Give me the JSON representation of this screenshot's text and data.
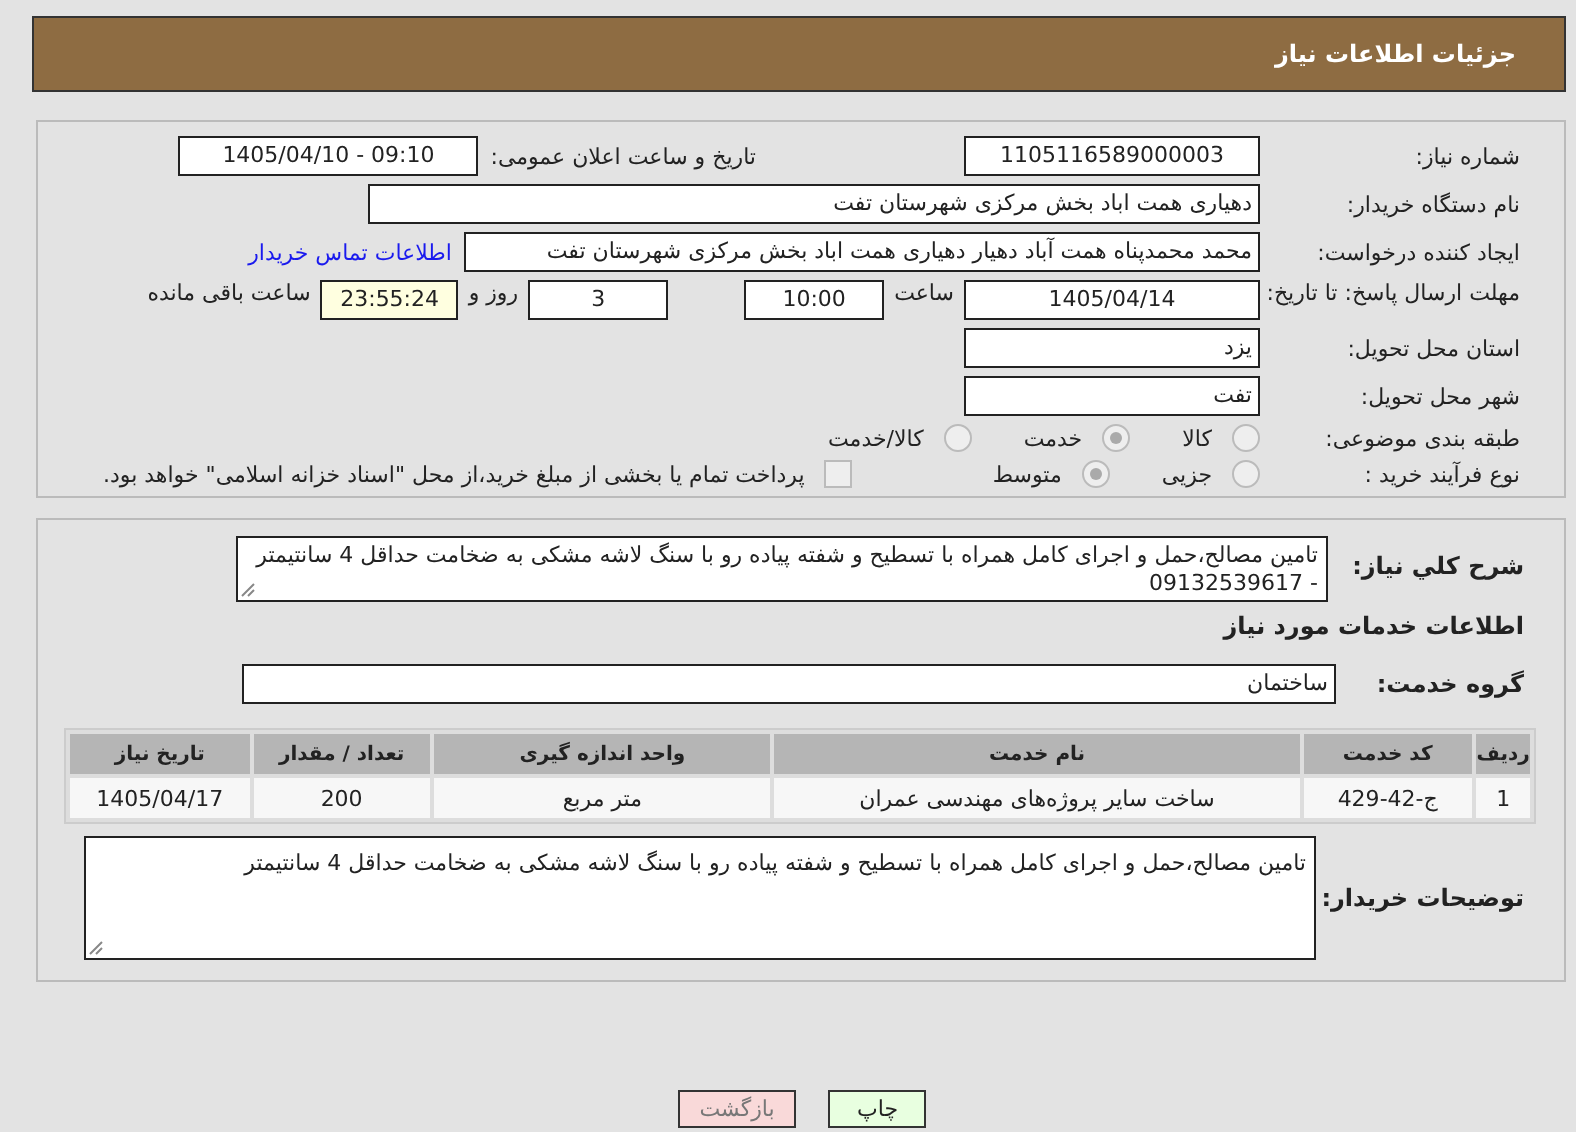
{
  "header": {
    "title": "جزئیات اطلاعات نیاز"
  },
  "need_info": {
    "need_number": {
      "label": "شماره نیاز:",
      "value": "1105116589000003"
    },
    "announce_datetime": {
      "label": "تاریخ و ساعت اعلان عمومی:",
      "value": "1405/04/10 - 09:10"
    },
    "buyer_org": {
      "label": "نام دستگاه خریدار:",
      "value": "دهیاری همت اباد بخش مرکزی شهرستان تفت"
    },
    "requester": {
      "label": "ایجاد کننده درخواست:",
      "value": "محمد محمدپناه همت آباد دهیار دهیاری همت اباد بخش مرکزی شهرستان تفت",
      "link": "اطلاعات تماس خریدار"
    },
    "deadline": {
      "label": "مهلت ارسال پاسخ: تا تاریخ:",
      "date": "1405/04/14",
      "time_label": "ساعت",
      "time": "10:00",
      "days": "3",
      "days_label": "روز و",
      "remaining": "23:55:24",
      "remaining_label": "ساعت باقی مانده"
    },
    "province": {
      "label": "استان محل تحویل:",
      "value": "یزد"
    },
    "city": {
      "label": "شهر محل تحویل:",
      "value": "تفت"
    },
    "category": {
      "label": "طبقه بندی موضوعی:",
      "options": [
        {
          "label": "کالا",
          "selected": false
        },
        {
          "label": "خدمت",
          "selected": true
        },
        {
          "label": "کالا/خدمت",
          "selected": false
        }
      ]
    },
    "purchase_process": {
      "label": "نوع فرآیند خرید :",
      "options": [
        {
          "label": "جزیی",
          "selected": false
        },
        {
          "label": "متوسط",
          "selected": true
        }
      ],
      "payment_checkbox": {
        "checked": false,
        "label": "پرداخت تمام یا بخشی از مبلغ خرید،از محل \"اسناد خزانه اسلامی\" خواهد بود."
      }
    }
  },
  "services": {
    "description": {
      "label": "شرح کلي نياز:",
      "value": "تامین مصالح،حمل و اجرای کامل همراه با تسطیح و شفته پیاده رو با سنگ لاشه مشکی به ضخامت حداقل 4 سانتیمتر - 09132539617"
    },
    "heading": "اطلاعات خدمات مورد نیاز",
    "service_group": {
      "label": "گروه خدمت:",
      "value": "ساختمان"
    },
    "table": {
      "columns": [
        "ردیف",
        "کد خدمت",
        "نام خدمت",
        "واحد اندازه گیری",
        "تعداد / مقدار",
        "تاریخ نیاز"
      ],
      "rows": [
        [
          "1",
          "ج-42-429",
          "ساخت سایر پروژه‌های مهندسی عمران",
          "متر مربع",
          "200",
          "1405/04/17"
        ]
      ]
    },
    "buyer_notes": {
      "label": "توضیحات خریدار:",
      "value": "تامین مصالح،حمل و اجرای کامل همراه با تسطیح و شفته پیاده رو با سنگ لاشه مشکی به ضخامت حداقل 4 سانتیمتر"
    }
  },
  "buttons": [
    {
      "kind": "print",
      "label": "چاپ"
    },
    {
      "kind": "back",
      "label": "بازگشت"
    }
  ]
}
